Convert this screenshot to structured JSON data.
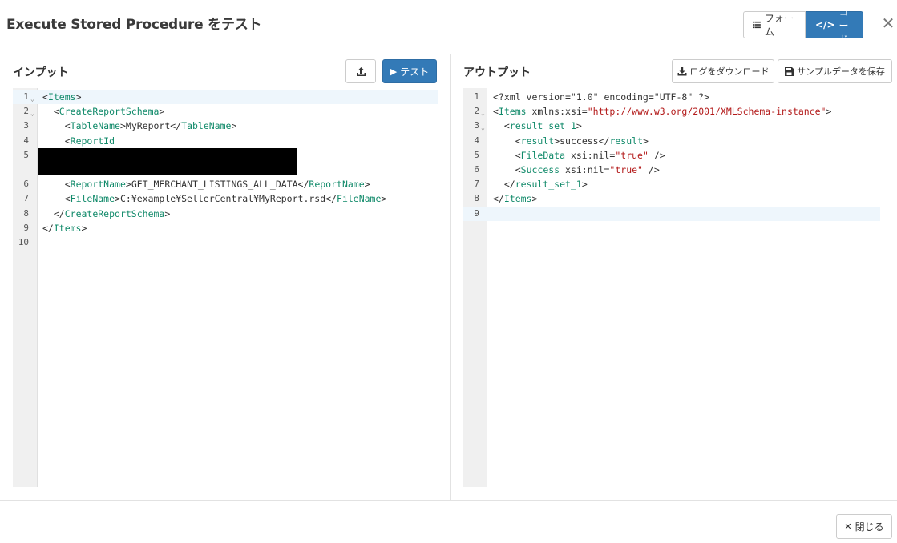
{
  "header": {
    "title": "Execute Stored Procedure をテスト",
    "form_label": "フォーム",
    "code_label": "コード",
    "close_symbol": "✕",
    "accent_color": "#337ab7"
  },
  "input_panel": {
    "title": "インプット",
    "test_label": "テスト",
    "upload_icon": "upload-icon",
    "lines": [
      {
        "num": "1",
        "fold": "⌄",
        "text": "<Items>"
      },
      {
        "num": "2",
        "fold": "⌄",
        "text": "  <CreateReportSchema>"
      },
      {
        "num": "3",
        "fold": "",
        "text": "    <TableName>MyReport</TableName>"
      },
      {
        "num": "4",
        "fold": "",
        "text": "    <ReportId"
      },
      {
        "num": "5",
        "fold": "",
        "text": ""
      },
      {
        "num": "6",
        "fold": "",
        "text": "    <ReportName>GET_MERCHANT_LISTINGS_ALL_DATA</ReportName>"
      },
      {
        "num": "7",
        "fold": "",
        "text": "    <FileName>C:¥example¥SellerCentral¥MyReport.rsd</FileName>"
      },
      {
        "num": "8",
        "fold": "",
        "text": "  </CreateReportSchema>"
      },
      {
        "num": "9",
        "fold": "",
        "text": "</Items>"
      },
      {
        "num": "10",
        "fold": "",
        "text": ""
      }
    ]
  },
  "output_panel": {
    "title": "アウトプット",
    "download_log_label": "ログをダウンロード",
    "save_sample_label": "サンプルデータを保存",
    "lines": [
      {
        "num": "1",
        "fold": "",
        "text": "<?xml version=\"1.0\" encoding=\"UTF-8\" ?>"
      },
      {
        "num": "2",
        "fold": "⌄",
        "text": "<Items xmlns:xsi=\"http://www.w3.org/2001/XMLSchema-instance\">"
      },
      {
        "num": "3",
        "fold": "⌄",
        "text": "  <result_set_1>"
      },
      {
        "num": "4",
        "fold": "",
        "text": "    <result>success</result>"
      },
      {
        "num": "5",
        "fold": "",
        "text": "    <FileData xsi:nil=\"true\" />"
      },
      {
        "num": "6",
        "fold": "",
        "text": "    <Success xsi:nil=\"true\" />"
      },
      {
        "num": "7",
        "fold": "",
        "text": "  </result_set_1>"
      },
      {
        "num": "8",
        "fold": "",
        "text": "</Items>"
      },
      {
        "num": "9",
        "fold": "",
        "text": ""
      }
    ]
  },
  "footer": {
    "close_label": "閉じる"
  }
}
